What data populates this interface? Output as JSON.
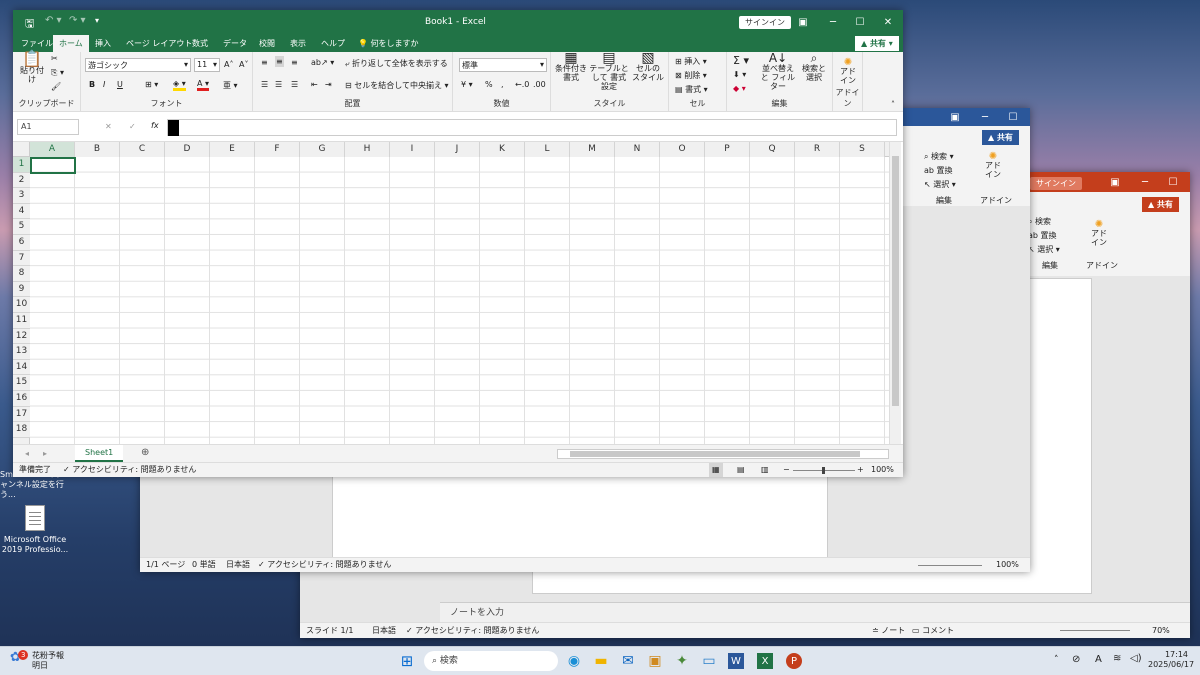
{
  "desktop": {
    "icons": [
      {
        "label": "Smartvisionのチ ャンネル設定を行う..."
      },
      {
        "label": "Microsoft Office 2019 Professio..."
      }
    ]
  },
  "excel": {
    "title": "Book1  -  Excel",
    "signin": "サインイン",
    "share": "共有",
    "tabs": [
      "ファイル",
      "ホーム",
      "挿入",
      "ページ レイアウト",
      "数式",
      "データ",
      "校閲",
      "表示",
      "ヘルプ"
    ],
    "tell_me": "何をしますか",
    "clipboard": {
      "paste": "貼り付け",
      "group": "クリップボード"
    },
    "font": {
      "name": "游ゴシック",
      "size": "11",
      "group": "フォント",
      "bold": "B",
      "italic": "I",
      "underline": "U"
    },
    "alignment": {
      "wrap": "折り返して全体を表示する",
      "merge": "セルを結合して中央揃え",
      "group": "配置"
    },
    "number": {
      "format": "標準",
      "group": "数値",
      "percent": "%"
    },
    "styles": {
      "conditional": "条件付き 書式",
      "table": "テーブルとして 書式設定",
      "cell": "セルの スタイル",
      "group": "スタイル"
    },
    "cells": {
      "insert": "挿入",
      "delete": "削除",
      "format": "書式",
      "group": "セル"
    },
    "editing": {
      "sort": "並べ替えと フィルター",
      "find": "検索と 選択",
      "group": "編集"
    },
    "addin": {
      "label": "アド イン",
      "group": "アドイン"
    },
    "namebox": "A1",
    "fx": "fx",
    "columns": [
      "A",
      "B",
      "C",
      "D",
      "E",
      "F",
      "G",
      "H",
      "I",
      "J",
      "K",
      "L",
      "M",
      "N",
      "O",
      "P",
      "Q",
      "R",
      "S"
    ],
    "rows": [
      "1",
      "2",
      "3",
      "4",
      "5",
      "6",
      "7",
      "8",
      "9",
      "10",
      "11",
      "12",
      "13",
      "14",
      "15",
      "16",
      "17",
      "18"
    ],
    "sheet_tab": "Sheet1",
    "status_ready": "準備完了",
    "status_access": "アクセシビリティ: 問題ありません",
    "zoom": "100%"
  },
  "word": {
    "share": "共有",
    "find": "検索",
    "replace": "置換",
    "select": "選択",
    "edit_group": "編集",
    "addin": "アド イン",
    "addin_group": "アドイン",
    "status_page": "1/1 ページ",
    "status_words": "0 単語",
    "status_lang": "日本語",
    "status_access": "アクセシビリティ: 問題ありません",
    "zoom": "100%"
  },
  "ppt": {
    "signin": "サインイン",
    "share": "共有",
    "find": "検索",
    "replace": "置換",
    "select": "選択",
    "edit_group": "編集",
    "addin": "アド イン",
    "addin_group": "アドイン",
    "notes_placeholder": "ノートを入力",
    "status_slide": "スライド 1/1",
    "status_lang": "日本語",
    "status_access": "アクセシビリティ: 問題ありません",
    "notes_btn": "ノート",
    "comment_btn": "コメント",
    "zoom": "70%"
  },
  "taskbar": {
    "weather_title": "花粉予報",
    "weather_sub": "明日",
    "weather_badge": "3",
    "search": "検索",
    "time": "17:14",
    "date": "2025/06/17",
    "ime": "A"
  }
}
